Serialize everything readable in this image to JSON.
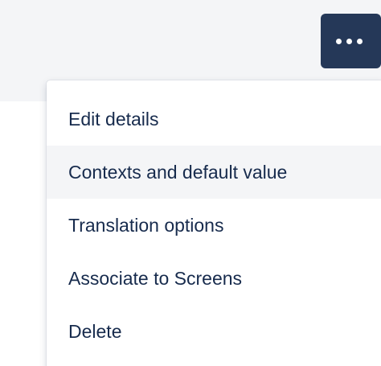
{
  "toolbar": {
    "more_button_icon": "more-horizontal-icon"
  },
  "menu": {
    "items": [
      {
        "label": "Edit details"
      },
      {
        "label": "Contexts and default value"
      },
      {
        "label": "Translation options"
      },
      {
        "label": "Associate to Screens"
      },
      {
        "label": "Delete"
      }
    ],
    "highlighted_index": 1
  },
  "colors": {
    "button_bg": "#253858",
    "header_bg": "#f4f5f7",
    "menu_text": "#172b4d",
    "hover_bg": "#f4f5f7"
  }
}
